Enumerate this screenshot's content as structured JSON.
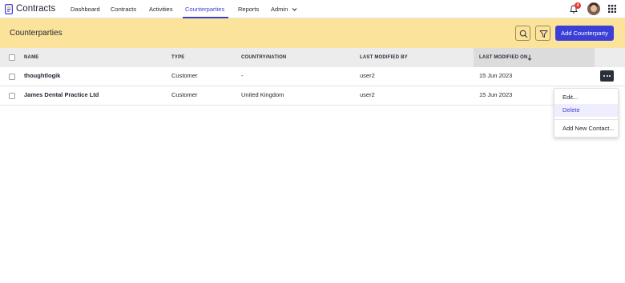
{
  "app": {
    "title": "Contracts"
  },
  "nav": {
    "items": [
      {
        "label": "Dashboard"
      },
      {
        "label": "Contracts"
      },
      {
        "label": "Activities"
      },
      {
        "label": "Counterparties"
      },
      {
        "label": "Reports"
      },
      {
        "label": "Admin"
      }
    ],
    "active": "Counterparties",
    "notification_count": "4"
  },
  "header": {
    "title": "Counterparties",
    "add_button": "Add Counterparty"
  },
  "table": {
    "columns": {
      "name": "NAME",
      "type": "TYPE",
      "country": "COUNTRY/NATION",
      "modified_by": "LAST MODIFIED BY",
      "modified_on": "LAST MODIFIED ON"
    },
    "sort": {
      "column": "LAST MODIFIED ON",
      "direction": "desc"
    },
    "rows": [
      {
        "name": "thoughtlogik",
        "type": "Customer",
        "country": "-",
        "modified_by": "user2",
        "modified_on": "15 Jun 2023"
      },
      {
        "name": "James Dental Practice Ltd",
        "type": "Customer",
        "country": "United Kingdom",
        "modified_by": "user2",
        "modified_on": "15 Jun 2023"
      }
    ]
  },
  "row_menu": {
    "items": [
      {
        "label": "Edit..."
      },
      {
        "label": "Delete"
      },
      {
        "label": "Add New Contact..."
      }
    ],
    "highlighted": "Delete"
  },
  "colors": {
    "accent": "#3c3fd6",
    "header_band": "#fbe39c",
    "badge": "#e53935"
  },
  "icons": [
    "contracts-logo-icon",
    "chevron-down-icon",
    "bell-icon",
    "apps-grid-icon",
    "search-icon",
    "filter-icon",
    "sort-down-icon",
    "more-icon"
  ]
}
